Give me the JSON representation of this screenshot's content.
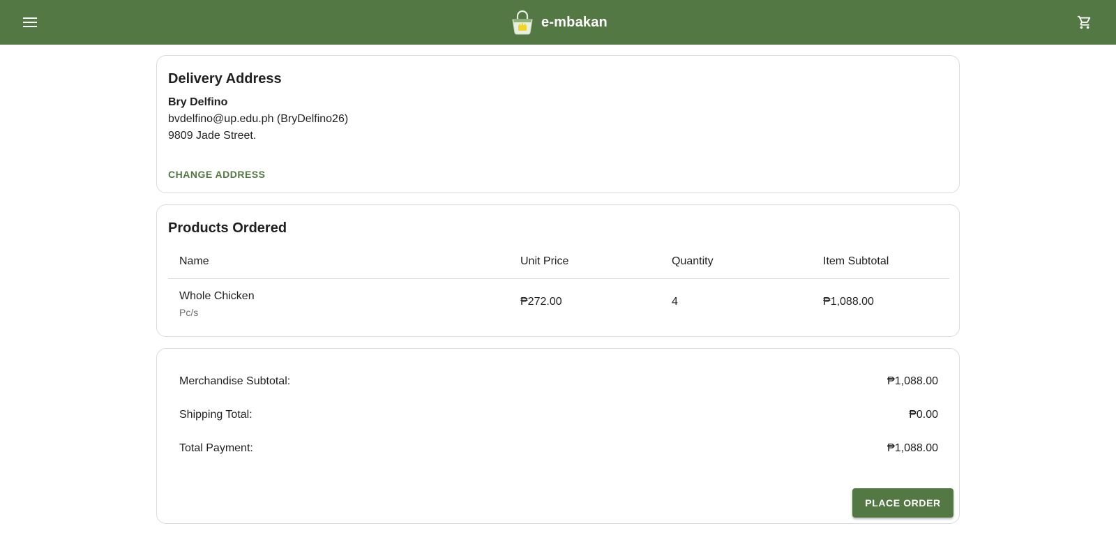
{
  "app": {
    "name": "e-mbakan",
    "colors": {
      "primary": "#537844",
      "text": "#1f1f1f",
      "muted": "#6b6b6b",
      "border": "#dcdcdc"
    },
    "icons": {
      "menu": "menu-icon",
      "cart": "cart-icon",
      "logo": "basket-logo"
    }
  },
  "delivery": {
    "title": "Delivery Address",
    "name": "Bry Delfino",
    "email_line": "bvdelfino@up.edu.ph (BryDelfino26)",
    "street": "9809 Jade Street.",
    "change_label": "CHANGE ADDRESS"
  },
  "products": {
    "title": "Products Ordered",
    "columns": [
      "Name",
      "Unit Price",
      "Quantity",
      "Item Subtotal"
    ],
    "rows": [
      {
        "name": "Whole Chicken",
        "unit": "Pc/s",
        "price": "₱272.00",
        "quantity": "4",
        "subtotal": "₱1,088.00"
      }
    ]
  },
  "summary": {
    "merch_label": "Merchandise Subtotal:",
    "merch_value": "₱1,088.00",
    "shipping_label": "Shipping Total:",
    "shipping_value": "₱0.00",
    "total_label": "Total Payment:",
    "total_value": "₱1,088.00",
    "place_order_label": "PLACE ORDER"
  }
}
